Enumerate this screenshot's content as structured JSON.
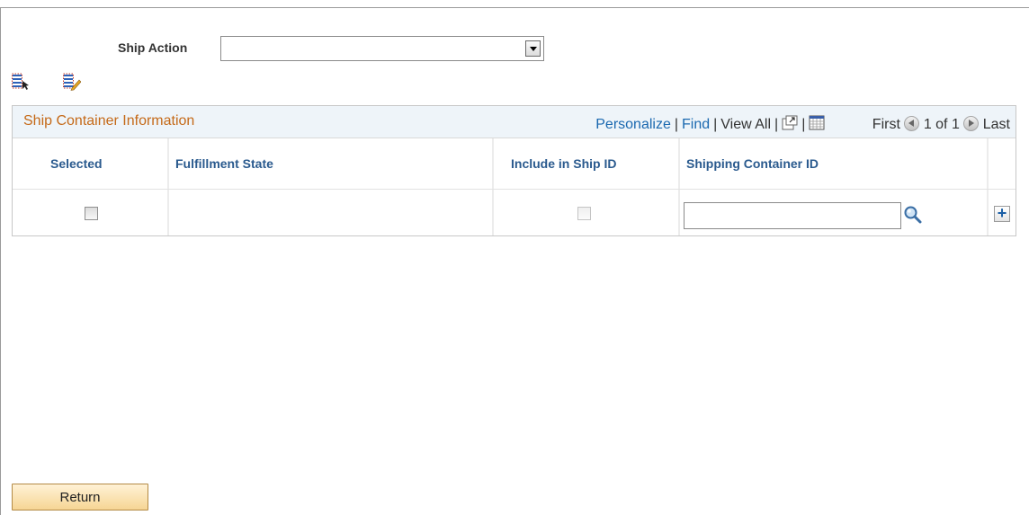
{
  "ship_action": {
    "label": "Ship Action",
    "selected_value": ""
  },
  "toolbar": {
    "icons": [
      "select-all-icon",
      "deselect-all-icon"
    ]
  },
  "grid": {
    "title": "Ship Container Information",
    "nav": {
      "personalize": "Personalize",
      "find": "Find",
      "view_all": "View All",
      "separator": "|",
      "first": "First",
      "page_info": "1 of 1",
      "last": "Last"
    },
    "columns": [
      "Selected",
      "Fulfillment State",
      "Include in Ship ID",
      "Shipping Container ID"
    ],
    "rows": [
      {
        "selected": false,
        "fulfillment_state": "",
        "include_in_ship_id": false,
        "shipping_container_id": ""
      }
    ]
  },
  "footer": {
    "return_label": "Return"
  },
  "colors": {
    "grid_title": "#c56a19",
    "link": "#1b69b0",
    "column_header": "#2a5a8e",
    "grid_bar_bg": "#eef4f9",
    "return_button": "#f6d594"
  }
}
